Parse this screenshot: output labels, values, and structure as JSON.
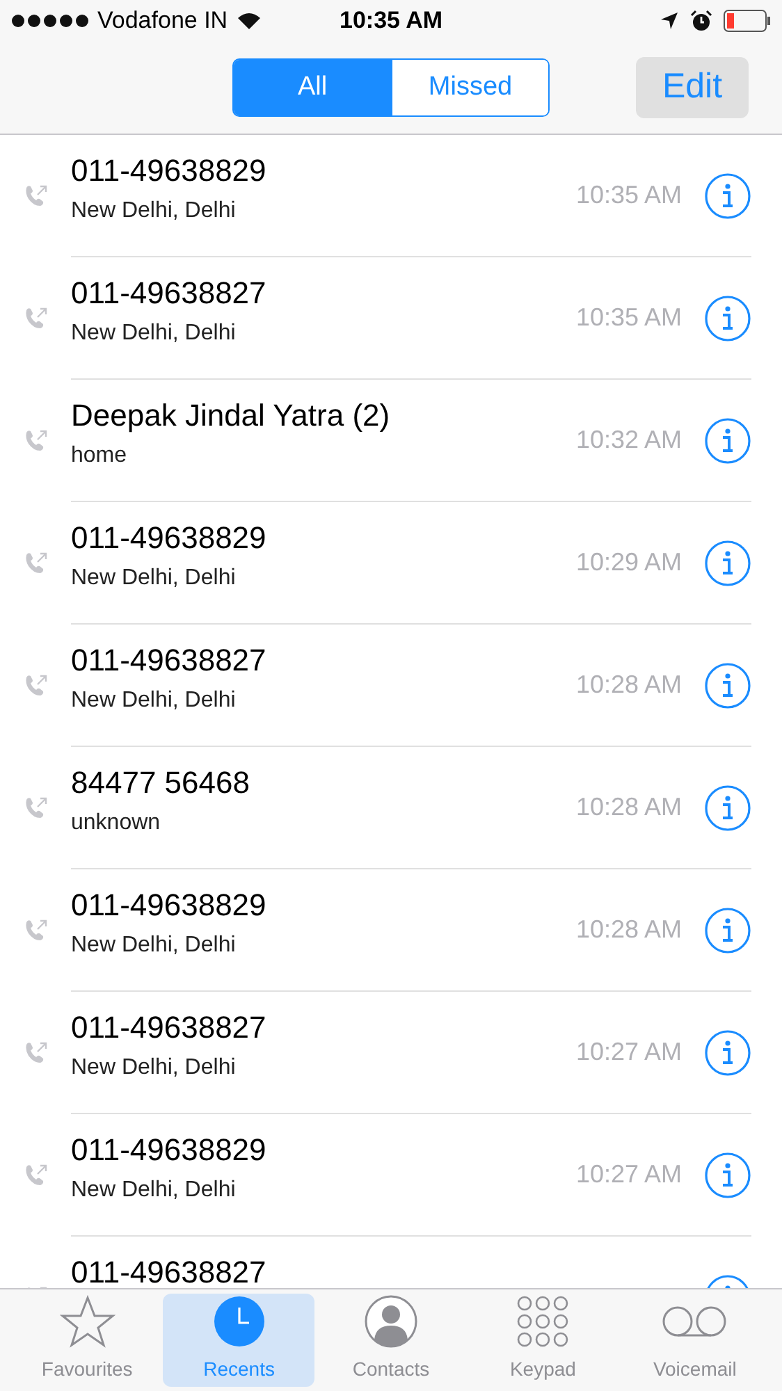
{
  "status_bar": {
    "carrier": "Vodafone IN",
    "time": "10:35 AM"
  },
  "segments": [
    {
      "label": "All",
      "selected": true
    },
    {
      "label": "Missed",
      "selected": false
    }
  ],
  "edit_button": "Edit",
  "calls": [
    {
      "name": "011-49638829",
      "detail": "New Delhi, Delhi",
      "time": "10:35 AM"
    },
    {
      "name": "011-49638827",
      "detail": "New Delhi, Delhi",
      "time": "10:35 AM"
    },
    {
      "name": "Deepak Jindal Yatra (2)",
      "detail": "home",
      "time": "10:32 AM"
    },
    {
      "name": "011-49638829",
      "detail": "New Delhi, Delhi",
      "time": "10:29 AM"
    },
    {
      "name": "011-49638827",
      "detail": "New Delhi, Delhi",
      "time": "10:28 AM"
    },
    {
      "name": "84477 56468",
      "detail": "unknown",
      "time": "10:28 AM"
    },
    {
      "name": "011-49638829",
      "detail": "New Delhi, Delhi",
      "time": "10:28 AM"
    },
    {
      "name": "011-49638827",
      "detail": "New Delhi, Delhi",
      "time": "10:27 AM"
    },
    {
      "name": "011-49638829",
      "detail": "New Delhi, Delhi",
      "time": "10:27 AM"
    },
    {
      "name": "011-49638827"
    }
  ],
  "tabs": [
    {
      "label": "Favourites",
      "kind": "star",
      "selected": false
    },
    {
      "label": "Recents",
      "kind": "clock",
      "selected": true
    },
    {
      "label": "Contacts",
      "kind": "person",
      "selected": false
    },
    {
      "label": "Keypad",
      "kind": "keypad",
      "selected": false
    },
    {
      "label": "Voicemail",
      "kind": "voicemail",
      "selected": false
    }
  ]
}
